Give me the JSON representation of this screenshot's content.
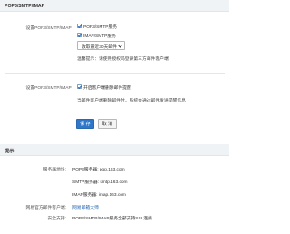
{
  "pop_section": {
    "title": "POP3/SMTP/IMAP",
    "setting_label": "设置POP3/SMTP/IMAP:",
    "pop3_smtp_option": "POP3/SMTP服务",
    "imap_smtp_option": "IMAP/SMTP服务",
    "receive_range_select": "收取最近30天邮件",
    "warm_tip": "温馨提示：请使用授权码登录第三方邮件客户端",
    "delete_setting_label": "设置POP3/SMTP/IMAP:",
    "delete_notify_option": "开启客户端删除邮件提醒",
    "delete_notify_desc": "当邮件客户端删除邮件时，系统会通过邮件发送提醒信息",
    "save_button": "保 存",
    "cancel_button": "取 消"
  },
  "tips_section": {
    "title": "提示",
    "server_address_label": "服务器地址:",
    "pop3_server": "POP3服务器: pop.163.com",
    "smtp_server": "SMTP服务器: smtp.163.com",
    "imap_server": "IMAP服务器: imap.163.com",
    "official_client_label": "网易官方邮件客户端:",
    "official_client_link": "网易邮箱大师",
    "security_label": "安全支持:",
    "security_value": "POP3/SMTP/IMAP服务全部支持SSL连接"
  },
  "colors": {
    "accent": "#2f78c9",
    "link": "#1f64b3",
    "header_bg": "#f0f3f6"
  }
}
